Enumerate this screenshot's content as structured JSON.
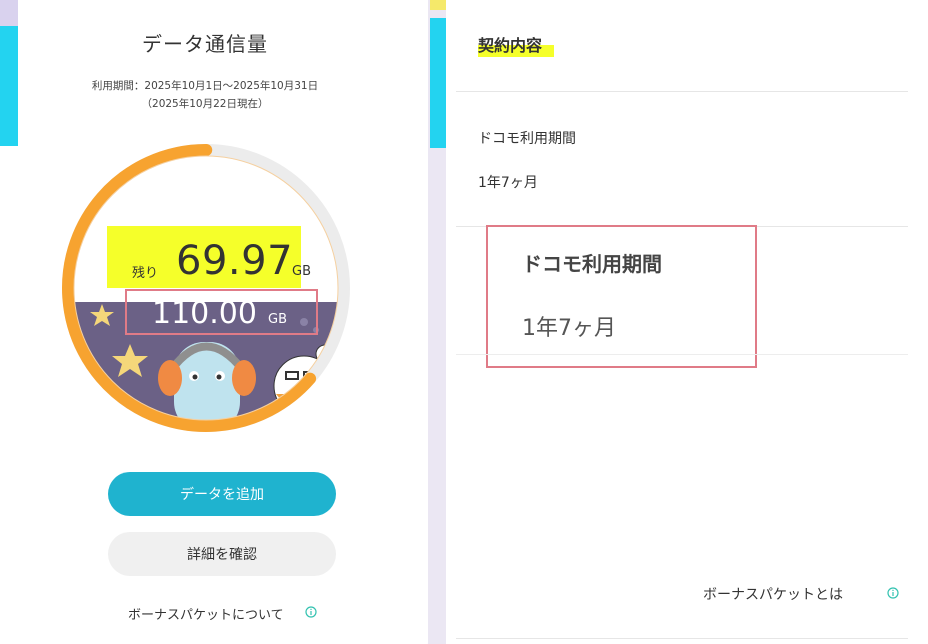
{
  "data_usage": {
    "title": "データ通信量",
    "period": "利用期間：2025年10月1日〜2025年10月31日",
    "as_of": "（2025年10月22日現在）",
    "remaining_label": "残り",
    "remaining_value": "69.97",
    "remaining_unit": "GB",
    "total_value": "110.00",
    "total_unit": "GB",
    "remaining_fraction": 0.636,
    "gauge_color": "#f7a330",
    "gauge_track_color": "#ececec",
    "add_data_button": "データを追加",
    "details_button": "詳細を確認",
    "bonus_packet_link": "ボーナスパケットについて",
    "info_icon": "info-circle-icon"
  },
  "contract": {
    "title": "契約内容",
    "items": [
      {
        "label": "ドコモ利用期間",
        "value": "1年7ヶ月"
      }
    ],
    "zoom_callout": {
      "label": "ドコモ利用期間",
      "value": "1年7ヶ月"
    },
    "bonus_packet_link": "ボーナスパケットとは",
    "info_icon": "info-circle-icon"
  },
  "colors": {
    "accent_cyan": "#1fb3cf",
    "highlight_yellow": "#f5ff2a",
    "callout_border": "#e07b87"
  }
}
